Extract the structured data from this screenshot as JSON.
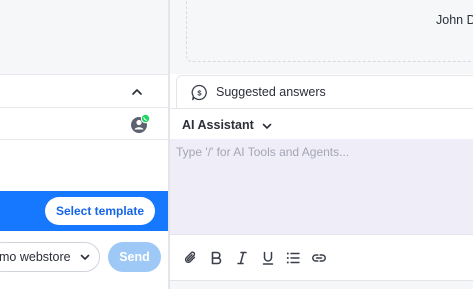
{
  "left_panel": {
    "template_button_label": "Select template",
    "store_select_value": "mo webstore",
    "send_label": "Send"
  },
  "right_panel": {
    "sender_name": "John D",
    "suggested_label": "Suggested answers",
    "assistant_label": "AI Assistant",
    "compose_placeholder": "Type '/' for AI Tools and Agents..."
  },
  "toolbar_icons": [
    "attachment-icon",
    "bold-icon",
    "italic-icon",
    "underline-icon",
    "bulleted-list-icon",
    "link-icon"
  ],
  "colors": {
    "accent_blue": "#1677ff",
    "send_disabled": "#9ec9f6",
    "compose_bg": "#efedf8",
    "whatsapp_green": "#25d366"
  }
}
